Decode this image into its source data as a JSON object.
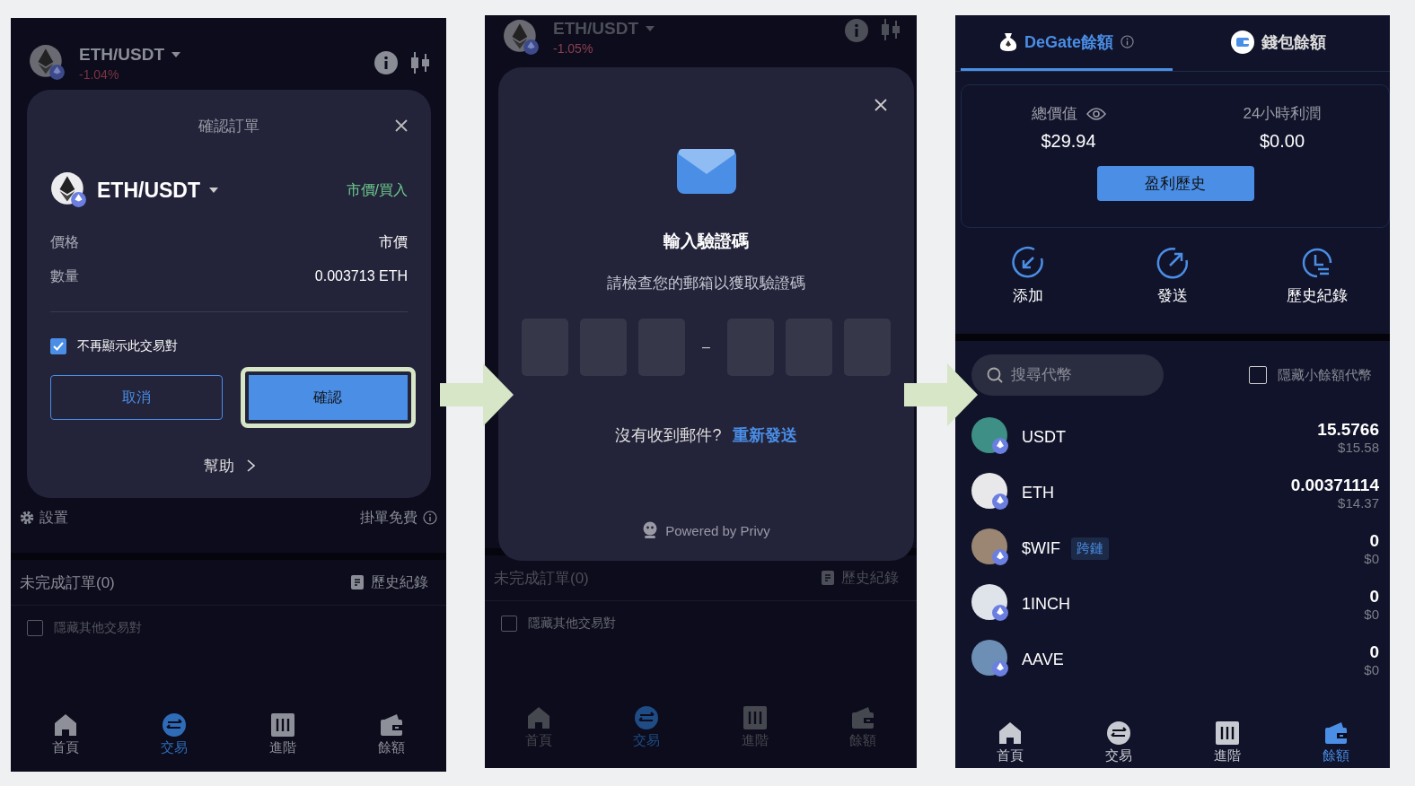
{
  "panels": [
    {
      "kind": "order_confirm",
      "header": {
        "pair": "ETH/USDT",
        "change": "-1.04%"
      },
      "dialog": {
        "title": "確認訂單",
        "pair": "ETH/USDT",
        "order_type": "市價/買入",
        "rows": [
          {
            "label": "價格",
            "value": "市價"
          },
          {
            "label": "數量",
            "value": "0.003713 ETH"
          }
        ],
        "remember": {
          "label": "不再顯示此交易對",
          "checked": true
        },
        "cancel": "取消",
        "confirm": {
          "label": "確認",
          "highlighted": true
        },
        "help": "幫助"
      },
      "settings": {
        "label": "設置",
        "fee": "掛單免費"
      },
      "orders": {
        "title": "未完成訂單(0)",
        "history": "歷史紀錄",
        "hide_others": {
          "label": "隱藏其他交易對",
          "checked": false
        }
      },
      "nav": [
        {
          "label": "首頁",
          "selected": false
        },
        {
          "label": "交易",
          "selected": true
        },
        {
          "label": "進階",
          "selected": false
        },
        {
          "label": "餘額",
          "selected": false
        }
      ]
    },
    {
      "kind": "verify_code",
      "header": {
        "pair": "ETH/USDT",
        "change": "-1.05%"
      },
      "dialog": {
        "title": "輸入驗證碼",
        "subtitle": "請檢查您的郵箱以獲取驗證碼",
        "code_groups": [
          {
            "cells": [
              {
                "filled": false
              },
              {
                "filled": false
              },
              {
                "filled": false
              }
            ]
          },
          {
            "cells": [
              {
                "filled": false
              },
              {
                "filled": false
              },
              {
                "filled": false
              }
            ]
          }
        ],
        "separator": "–",
        "resend_prompt": "沒有收到郵件?",
        "resend_link": "重新發送",
        "powered_by": "Powered by Privy"
      },
      "orders": {
        "title": "未完成訂單(0)",
        "history": "歷史紀錄",
        "hide_others": {
          "label": "隱藏其他交易對",
          "checked": false
        }
      },
      "nav": [
        {
          "label": "首頁",
          "selected": false
        },
        {
          "label": "交易",
          "selected": true
        },
        {
          "label": "進階",
          "selected": false
        },
        {
          "label": "餘額",
          "selected": false
        }
      ]
    },
    {
      "kind": "balance",
      "tabs": [
        {
          "label": "DeGate餘額",
          "selected": true
        },
        {
          "label": "錢包餘額",
          "selected": false
        }
      ],
      "stats": [
        {
          "label": "總價值",
          "value": "$29.94"
        },
        {
          "label": "24小時利潤",
          "value": "$0.00"
        }
      ],
      "profit_button": "盈利歷史",
      "actions": [
        {
          "label": "添加",
          "kind": "add"
        },
        {
          "label": "發送",
          "kind": "send"
        },
        {
          "label": "歷史紀錄",
          "kind": "history"
        }
      ],
      "search": {
        "placeholder": "搜尋代幣"
      },
      "hide_small": {
        "label": "隱藏小餘額代幣",
        "checked": false
      },
      "tokens": [
        {
          "symbol": "USDT",
          "amount": "15.5766",
          "usd": "$15.58",
          "color": "#3e8f86"
        },
        {
          "symbol": "ETH",
          "amount": "0.00371114",
          "usd": "$14.37",
          "color": "#e8e8eb"
        },
        {
          "symbol": "$WIF",
          "tag": "跨鏈",
          "amount": "0",
          "usd": "$0",
          "color": "#9a8672"
        },
        {
          "symbol": "1INCH",
          "amount": "0",
          "usd": "$0",
          "color": "#dfe3ea"
        },
        {
          "symbol": "AAVE",
          "amount": "0",
          "usd": "$0",
          "color": "#6d8fb5"
        }
      ],
      "nav": [
        {
          "label": "首頁",
          "selected": false
        },
        {
          "label": "交易",
          "selected": false
        },
        {
          "label": "進階",
          "selected": false
        },
        {
          "label": "餘額",
          "selected": true
        }
      ]
    }
  ]
}
